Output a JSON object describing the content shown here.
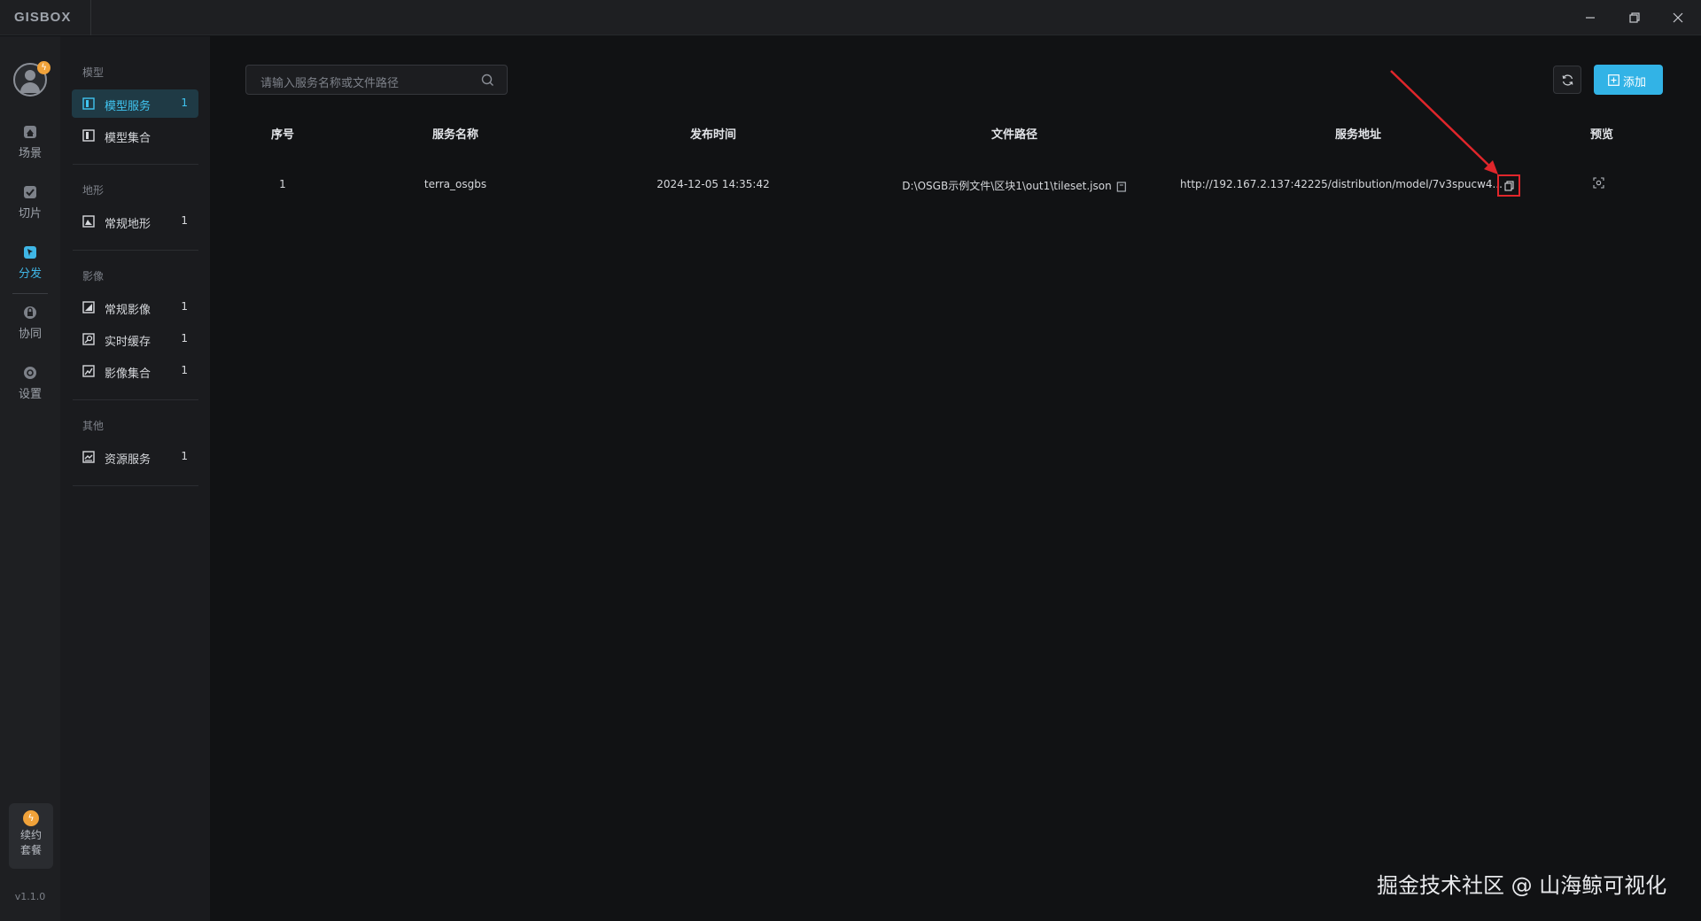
{
  "app": {
    "logo": "GISBOX",
    "window_controls": [
      "minimize",
      "maximize",
      "close"
    ]
  },
  "rail": {
    "items": [
      {
        "label": "场景",
        "icon": "scene-icon"
      },
      {
        "label": "切片",
        "icon": "slice-icon"
      },
      {
        "label": "分发",
        "icon": "distribute-icon",
        "active": true
      },
      {
        "label": "协同",
        "icon": "collaborate-icon"
      },
      {
        "label": "设置",
        "icon": "settings-icon"
      }
    ],
    "renew_line1": "续约",
    "renew_line2": "套餐",
    "version": "v1.1.0"
  },
  "sidebar": {
    "sections": [
      {
        "title": "模型",
        "items": [
          {
            "label": "模型服务",
            "count": "1",
            "active": true
          },
          {
            "label": "模型集合",
            "count": ""
          }
        ]
      },
      {
        "title": "地形",
        "items": [
          {
            "label": "常规地形",
            "count": "1"
          }
        ]
      },
      {
        "title": "影像",
        "items": [
          {
            "label": "常规影像",
            "count": "1"
          },
          {
            "label": "实时缓存",
            "count": "1"
          },
          {
            "label": "影像集合",
            "count": "1"
          }
        ]
      },
      {
        "title": "其他",
        "items": [
          {
            "label": "资源服务",
            "count": "1"
          }
        ]
      }
    ]
  },
  "toolbar": {
    "search_placeholder": "请输入服务名称或文件路径",
    "add_label": "添加"
  },
  "table": {
    "headers": [
      "序号",
      "服务名称",
      "发布时间",
      "文件路径",
      "服务地址",
      "预览"
    ],
    "rows": [
      {
        "index": "1",
        "name": "terra_osgbs",
        "time": "2024-12-05 14:35:42",
        "path": "D:\\OSGB示例文件\\区块1\\out1\\tileset.json",
        "url": "http://192.167.2.137:42225/distribution/model/7v3spucw4..."
      }
    ]
  },
  "colors": {
    "accent": "#32b3e6",
    "highlight_box": "#e0262b",
    "badge": "#f0a23a"
  },
  "watermark": "掘金技术社区 @ 山海鲸可视化"
}
